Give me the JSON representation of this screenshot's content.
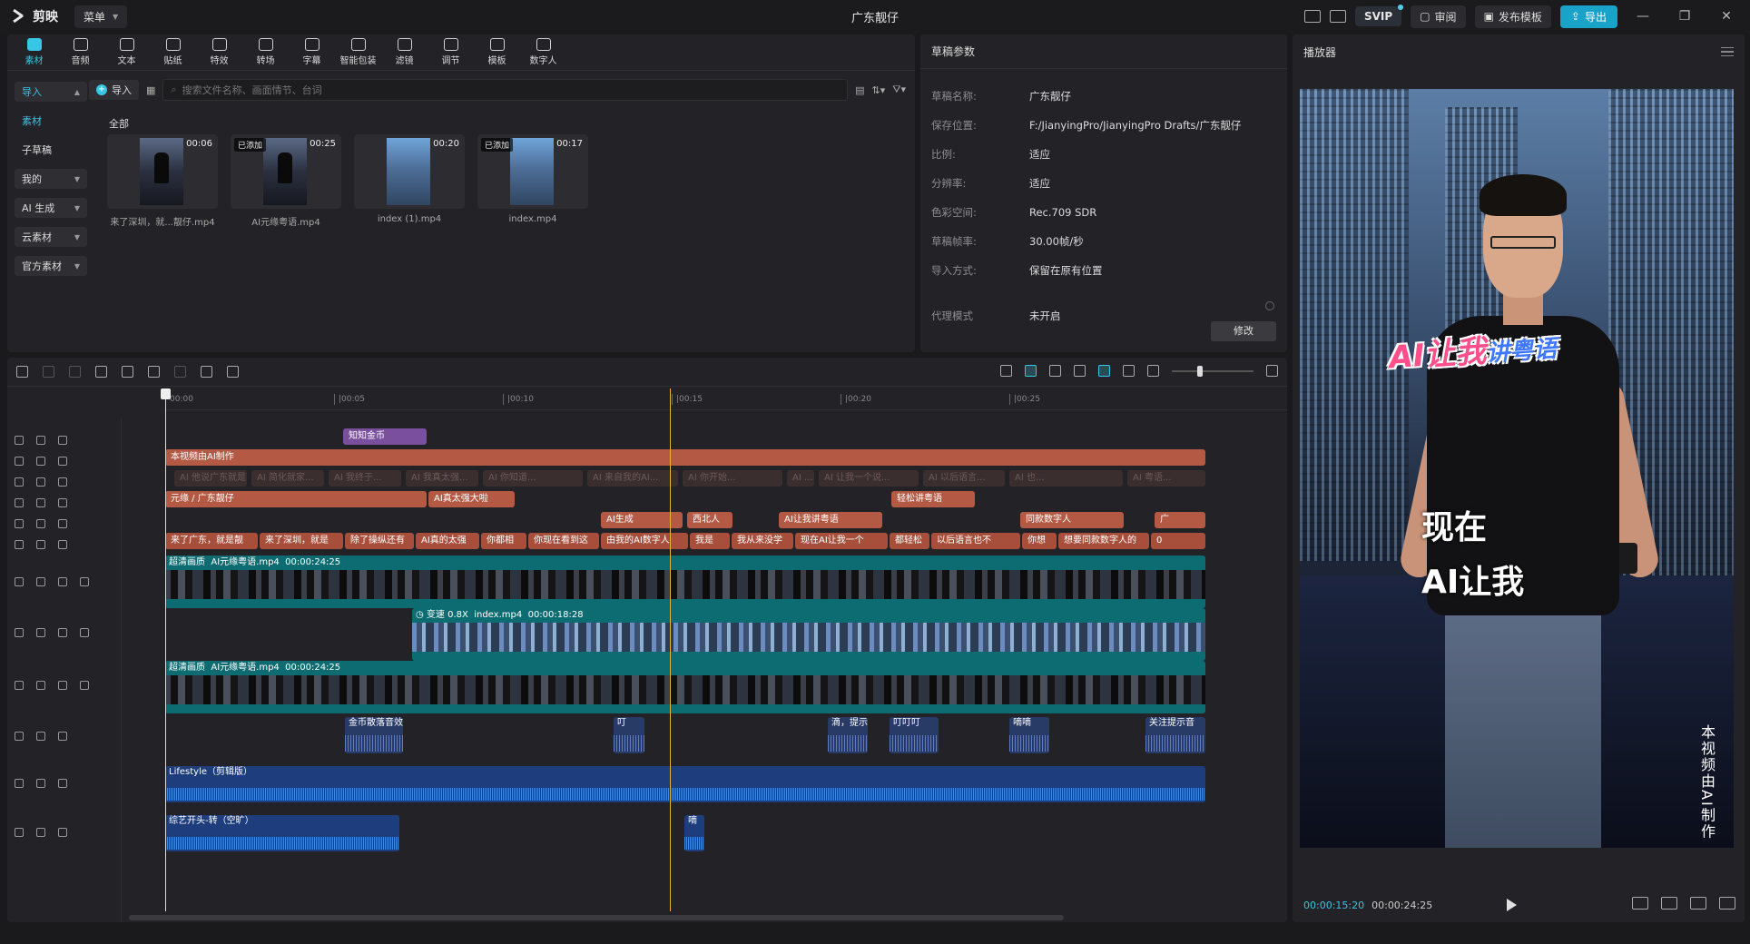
{
  "app": {
    "logo": "剪映",
    "menu": "菜单",
    "title": "广东靓仔"
  },
  "topbar": {
    "svip": "SVIP",
    "review": "审阅",
    "publish_template": "发布模板",
    "export": "导出"
  },
  "toolbar": {
    "tabs": [
      {
        "label": "素材",
        "icon": "media-icon"
      },
      {
        "label": "音频",
        "icon": "audio-icon"
      },
      {
        "label": "文本",
        "icon": "text-icon"
      },
      {
        "label": "贴纸",
        "icon": "sticker-icon"
      },
      {
        "label": "特效",
        "icon": "effects-icon"
      },
      {
        "label": "转场",
        "icon": "transition-icon"
      },
      {
        "label": "字幕",
        "icon": "caption-icon"
      },
      {
        "label": "智能包装",
        "icon": "smart-pack-icon"
      },
      {
        "label": "滤镜",
        "icon": "filter-icon"
      },
      {
        "label": "调节",
        "icon": "adjust-icon"
      },
      {
        "label": "模板",
        "icon": "template-icon"
      },
      {
        "label": "数字人",
        "icon": "avatar-icon"
      }
    ]
  },
  "sidebar": {
    "items": [
      {
        "label": "导入"
      },
      {
        "label": "素材"
      },
      {
        "label": "子草稿"
      },
      {
        "label": "我的"
      },
      {
        "label": "AI 生成"
      },
      {
        "label": "云素材"
      },
      {
        "label": "官方素材"
      }
    ]
  },
  "media": {
    "import_label": "导入",
    "search_placeholder": "搜索文件名称、画面情节、台词",
    "section": "全部",
    "items": [
      {
        "name": "来了深圳，就...靓仔.mp4",
        "duration": "00:06",
        "badge": ""
      },
      {
        "name": "AI元缘粤语.mp4",
        "duration": "00:25",
        "badge": "已添加"
      },
      {
        "name": "index (1).mp4",
        "duration": "00:20",
        "badge": ""
      },
      {
        "name": "index.mp4",
        "duration": "00:17",
        "badge": "已添加"
      }
    ]
  },
  "draft": {
    "title": "草稿参数",
    "fields": [
      {
        "k": "草稿名称:",
        "v": "广东靓仔"
      },
      {
        "k": "保存位置:",
        "v": "F:/JianyingPro/JianyingPro Drafts/广东靓仔"
      },
      {
        "k": "比例:",
        "v": "适应"
      },
      {
        "k": "分辨率:",
        "v": "适应"
      },
      {
        "k": "色彩空间:",
        "v": "Rec.709 SDR"
      },
      {
        "k": "草稿帧率:",
        "v": "30.00帧/秒"
      },
      {
        "k": "导入方式:",
        "v": "保留在原有位置"
      },
      {
        "k": "代理模式",
        "v": "未开启"
      }
    ],
    "modify": "修改"
  },
  "player": {
    "title": "播放器",
    "shirt_text_a": "AI让我",
    "shirt_text_b": "讲粤语",
    "subtitle_1": "现在",
    "subtitle_2": "AI让我",
    "vertical_note": "本视频由AI制作",
    "current_time": "00:00:15:20",
    "total_time": "00:00:24:25"
  },
  "ruler": [
    "00:00",
    "|00:05",
    "|00:10",
    "|00:15",
    "|00:20",
    "|00:25"
  ],
  "timeline": {
    "effect_clip": "知知金币",
    "text_main": "本视频由AI制作",
    "ghost_track": [
      "AI 他说广东就是...",
      "AI 简化就家...",
      "AI 我终于...",
      "AI 我真太强...",
      "AI 你知道...",
      "AI 来自我的AI...",
      "AI 你开始...",
      "AI ...",
      "AI 让我一个说...",
      "AI 以后语言...",
      "AI 也...",
      "AI 粤语..."
    ],
    "row3": [
      {
        "label": "元缘 / 广东靓仔"
      },
      {
        "label": "AI真太强大啦"
      },
      {
        "label": "轻松讲粤语"
      }
    ],
    "row4": [
      {
        "label": "AI生成"
      },
      {
        "label": "西北人"
      },
      {
        "label": "AI让我讲粤语"
      },
      {
        "label": "同款数字人"
      },
      {
        "label": "广"
      }
    ],
    "row5": [
      "来了广东，就是靓",
      "来了深圳，就是",
      "除了操纵还有",
      "AI真的太强",
      "你都相",
      "你现在看到这",
      "由我的AI数字人",
      "我是",
      "我从来没学",
      "现在AI让我一个",
      "都轻松",
      "以后语言也不",
      "你想",
      "想要同款数字人的",
      "0"
    ],
    "video1": {
      "tag": "超清画质",
      "name": "AI元缘粤语.mp4",
      "dur": "00:00:24:25"
    },
    "video2": {
      "tag": "变速 0.8X",
      "name": "index.mp4",
      "dur": "00:00:18:28"
    },
    "video3": {
      "tag": "超清画质",
      "name": "AI元缘粤语.mp4",
      "dur": "00:00:24:25"
    },
    "audio1": [
      "金币散落音效",
      "叮",
      "滴，提示",
      "叮叮叮",
      "嘀嘀",
      "关注提示音"
    ],
    "music": "Lifestyle（剪辑版）",
    "audio3": [
      "综艺开头-转（空旷）",
      "嘀"
    ]
  }
}
